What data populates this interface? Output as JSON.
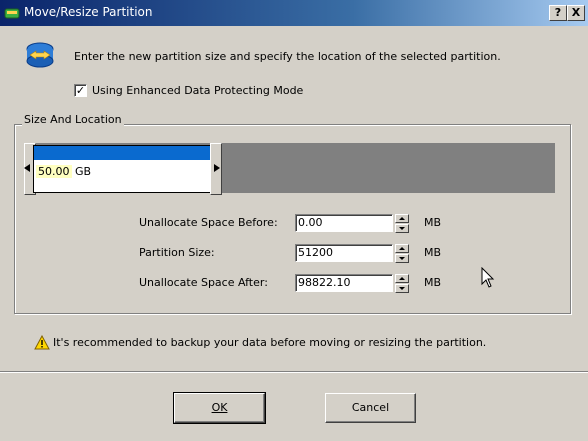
{
  "window": {
    "title": "Move/Resize Partition",
    "help_label": "?",
    "close_label": "X"
  },
  "instruction": "Enter the new partition size and specify the location of the selected partition.",
  "protect_mode": {
    "label": "Using Enhanced Data Protecting Mode",
    "checked": true,
    "mark": "✓"
  },
  "size_location": {
    "group_label": "Size And Location",
    "partition_size_value": "50.00",
    "partition_size_unit": "GB",
    "partition_fill_fraction": 0.345
  },
  "fields": [
    {
      "label": "Unallocate Space Before:",
      "value": "0.00",
      "unit": "MB"
    },
    {
      "label": "Partition Size:",
      "value": "51200",
      "unit": "MB"
    },
    {
      "label": "Unallocate Space After:",
      "value": "98822.10",
      "unit": "MB"
    }
  ],
  "warning": "It's recommended to backup your data before moving or resizing the partition.",
  "buttons": {
    "ok_label": "OK",
    "cancel_label": "Cancel"
  },
  "colors": {
    "titlebar": "#0a246a",
    "partition_fill": "#0a6acf",
    "unallocated": "#808080"
  }
}
